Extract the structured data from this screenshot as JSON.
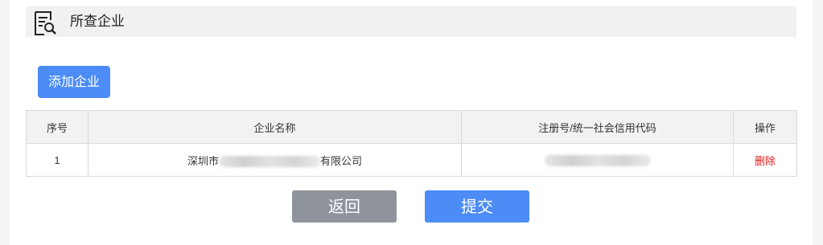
{
  "section": {
    "title": "所查企业",
    "icon": "document-search-icon"
  },
  "actions": {
    "add_label": "添加企业",
    "back_label": "返回",
    "submit_label": "提交"
  },
  "table": {
    "headers": [
      "序号",
      "企业名称",
      "注册号/统一社会信用代码",
      "操作"
    ],
    "rows": [
      {
        "index": "1",
        "name_prefix": "深圳市",
        "name_suffix": "有限公司",
        "code": "",
        "action": "删除"
      }
    ]
  },
  "colors": {
    "primary": "#4b8cf6",
    "secondary": "#8f939c",
    "danger": "#e21b1b",
    "header_bg": "#f1f1f1"
  }
}
